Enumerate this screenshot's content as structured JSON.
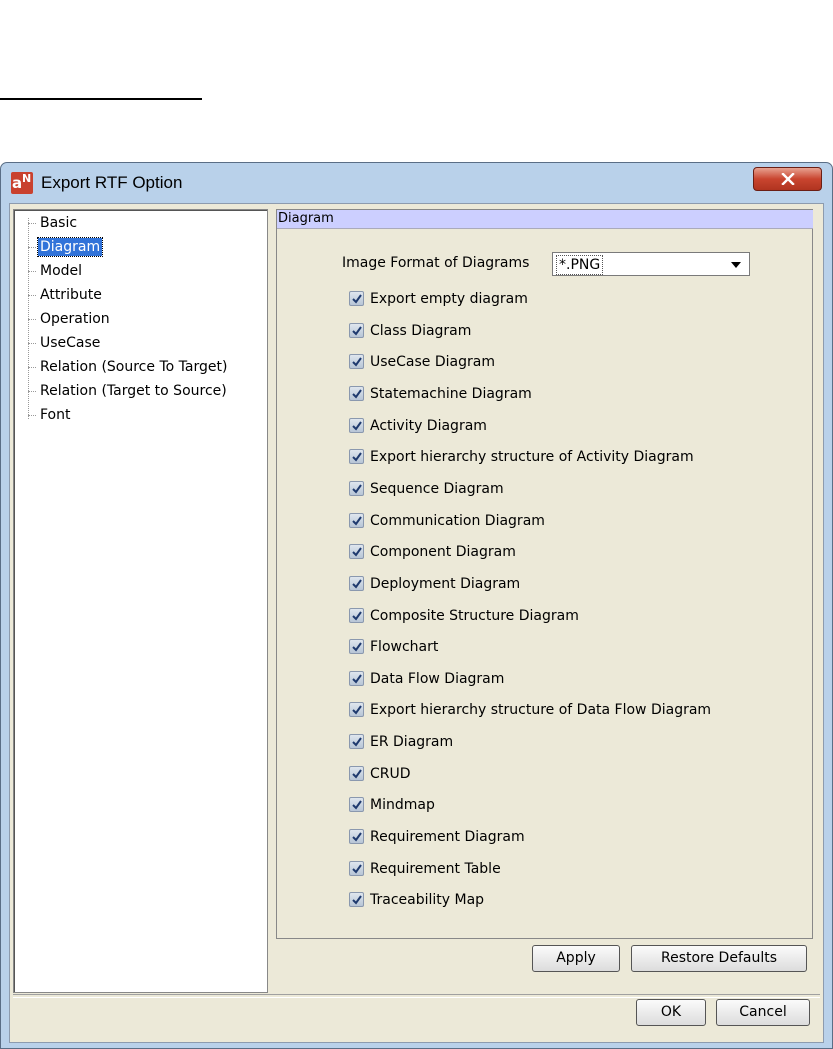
{
  "window": {
    "title": "Export RTF Option",
    "app_icon_text": "a",
    "app_icon_sub": "N"
  },
  "tree": {
    "items": [
      {
        "label": "Basic",
        "selected": false
      },
      {
        "label": "Diagram",
        "selected": true
      },
      {
        "label": "Model",
        "selected": false
      },
      {
        "label": "Attribute",
        "selected": false
      },
      {
        "label": "Operation",
        "selected": false
      },
      {
        "label": "UseCase",
        "selected": false
      },
      {
        "label": "Relation (Source To Target)",
        "selected": false
      },
      {
        "label": "Relation (Target to Source)",
        "selected": false
      },
      {
        "label": "Font",
        "selected": false
      }
    ]
  },
  "panel": {
    "header": "Diagram",
    "image_format_label": "Image Format of Diagrams",
    "image_format_value": "*.PNG",
    "checkboxes": [
      {
        "label": "Export empty diagram",
        "checked": true
      },
      {
        "label": "Class Diagram",
        "checked": true
      },
      {
        "label": "UseCase Diagram",
        "checked": true
      },
      {
        "label": "Statemachine Diagram",
        "checked": true
      },
      {
        "label": "Activity Diagram",
        "checked": true
      },
      {
        "label": "Export hierarchy structure of Activity Diagram",
        "checked": true
      },
      {
        "label": "Sequence Diagram",
        "checked": true
      },
      {
        "label": "Communication Diagram",
        "checked": true
      },
      {
        "label": "Component Diagram",
        "checked": true
      },
      {
        "label": "Deployment Diagram",
        "checked": true
      },
      {
        "label": "Composite Structure Diagram",
        "checked": true
      },
      {
        "label": "Flowchart",
        "checked": true
      },
      {
        "label": "Data Flow Diagram",
        "checked": true
      },
      {
        "label": "Export hierarchy structure of Data Flow Diagram",
        "checked": true
      },
      {
        "label": "ER Diagram",
        "checked": true
      },
      {
        "label": "CRUD",
        "checked": true
      },
      {
        "label": "Mindmap",
        "checked": true
      },
      {
        "label": "Requirement Diagram",
        "checked": true
      },
      {
        "label": "Requirement Table",
        "checked": true
      },
      {
        "label": "Traceability Map",
        "checked": true
      }
    ],
    "apply_label": "Apply",
    "restore_label": "Restore Defaults"
  },
  "footer": {
    "ok_label": "OK",
    "cancel_label": "Cancel"
  },
  "icons": {
    "close": "close-icon",
    "dropdown": "chevron-down-icon",
    "check": "check-icon"
  },
  "colors": {
    "selection": "#3173d9",
    "panel_header": "#cccfff",
    "close_button": "#c9452f",
    "window_frame": "#b9d1ea"
  }
}
